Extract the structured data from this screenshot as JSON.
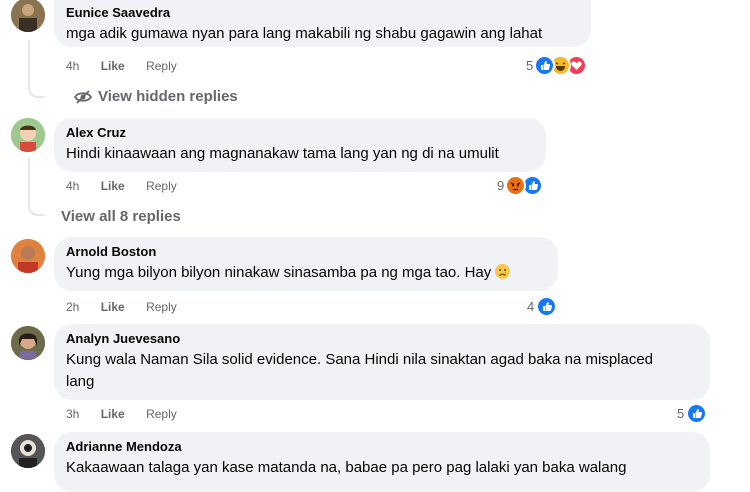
{
  "comments": [
    {
      "author": "Eunice Saavedra",
      "text_lines": [
        "mga adik gumawa nyan para lang makabili ng shabu gagawin ang lahat"
      ],
      "time": "4h",
      "like_label": "Like",
      "reply_label": "Reply",
      "reaction_count": "5",
      "reactions": [
        "like-icon",
        "haha-icon",
        "love-icon"
      ]
    },
    {
      "author": "Alex Cruz",
      "text_lines": [
        "Hindi kinaawaan ang magnanakaw tama lang yan ng di na umulit"
      ],
      "time": "4h",
      "like_label": "Like",
      "reply_label": "Reply",
      "reaction_count": "9",
      "reactions": [
        "angry-icon",
        "like-icon"
      ]
    },
    {
      "author": "Arnold Boston",
      "text_lines": [
        "Yung mga bilyon bilyon ninakaw sinasamba pa ng mga tao. Hay"
      ],
      "time": "2h",
      "like_label": "Like",
      "reply_label": "Reply",
      "reaction_count": "4",
      "reactions": [
        "like-icon"
      ],
      "inline_emoji": "sad-face-icon"
    },
    {
      "author": "Analyn Juevesano",
      "text_lines": [
        "Kung wala Naman Sila solid evidence. Sana Hindi nila sinaktan agad baka na misplaced",
        "lang"
      ],
      "time": "3h",
      "like_label": "Like",
      "reply_label": "Reply",
      "reaction_count": "5",
      "reactions": [
        "like-icon"
      ]
    },
    {
      "author": "Adrianne Mendoza",
      "text_lines": [
        "Kakaawaan talaga yan kase matanda na, babae pa pero pag lalaki yan baka walang"
      ]
    }
  ],
  "view_hidden_replies": "View hidden replies",
  "view_all_replies": "View all 8 replies",
  "colors": {
    "bubble": "#f0f2f5",
    "like_blue": "#1877f2",
    "love_red": "#f33e58",
    "haha_yellow": "#f7b928",
    "meta_gray": "#65676b"
  }
}
